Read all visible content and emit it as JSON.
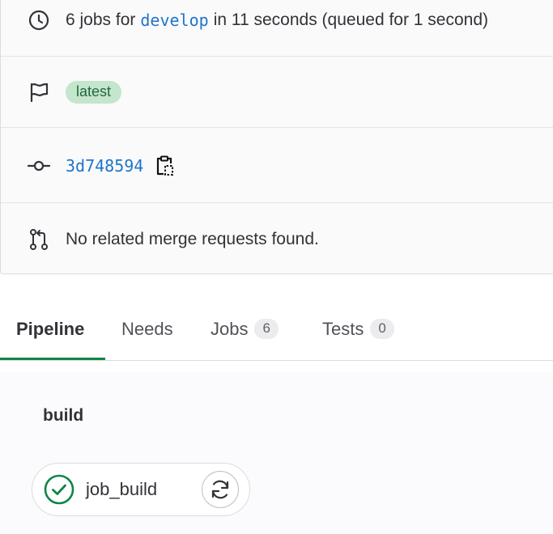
{
  "pipeline_info": {
    "duration_row": {
      "icon": "clock-icon",
      "prefix": "6 jobs for",
      "branch": "develop",
      "suffix": "in 11 seconds (queued for 1 second)"
    },
    "tag_row": {
      "icon": "flag-icon",
      "badge": "latest"
    },
    "commit_row": {
      "icon": "commit-icon",
      "sha": "3d748594",
      "copy_icon": "copy-to-clipboard-icon"
    },
    "merge_row": {
      "icon": "merge-request-icon",
      "text": "No related merge requests found."
    }
  },
  "tabs": [
    {
      "label": "Pipeline",
      "active": true
    },
    {
      "label": "Needs"
    },
    {
      "label": "Jobs",
      "count": "6"
    },
    {
      "label": "Tests",
      "count": "0"
    }
  ],
  "graph": {
    "stages": [
      {
        "name": "build",
        "jobs": [
          {
            "name": "job_build",
            "status": "success",
            "status_icon": "status-success-icon",
            "action_icon": "retry-icon"
          }
        ]
      }
    ]
  },
  "colors": {
    "link": "#1f75cb",
    "success": "#108548",
    "badge_bg": "#c3e6cd",
    "badge_text": "#24663b"
  }
}
